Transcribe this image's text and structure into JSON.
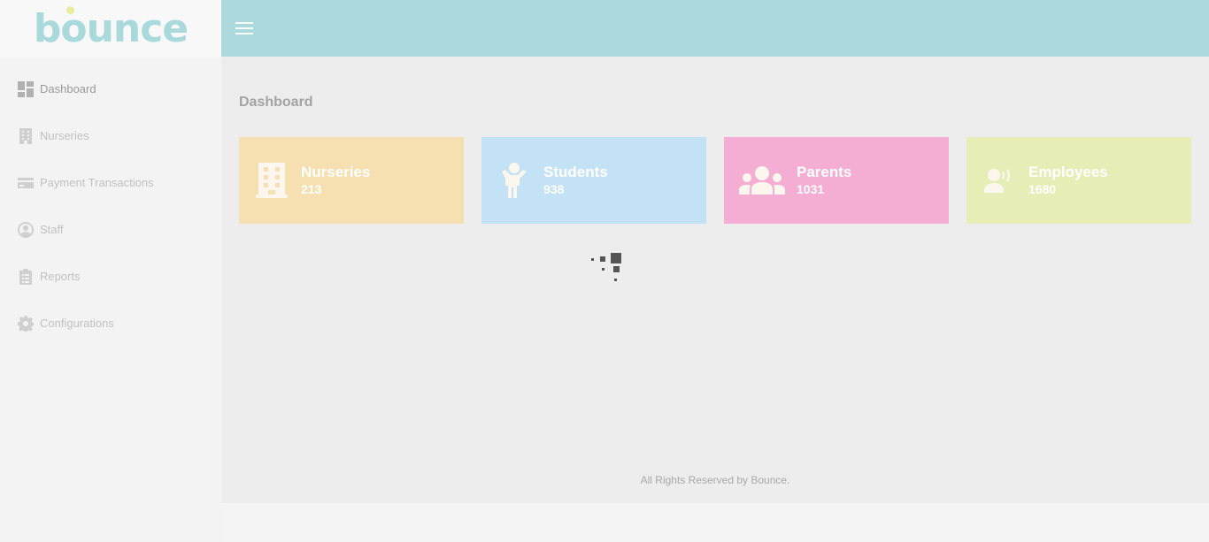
{
  "brand": {
    "logo_text": "bounce",
    "colors": {
      "logo": "#a9d9db",
      "logo_dot": "#e8ec9e",
      "topbar": "#acdadc"
    }
  },
  "sidebar": {
    "items": [
      {
        "label": "Dashboard",
        "icon": "dashboard-icon",
        "active": true
      },
      {
        "label": "Nurseries",
        "icon": "building-icon"
      },
      {
        "label": "Payment Transactions",
        "icon": "credit-card-icon"
      },
      {
        "label": "Staff",
        "icon": "user-circle-icon"
      },
      {
        "label": "Reports",
        "icon": "clipboard-list-icon"
      },
      {
        "label": "Configurations",
        "icon": "gear-icon"
      }
    ]
  },
  "topbar": {
    "menu_icon": "hamburger-icon"
  },
  "main": {
    "title": "Dashboard",
    "cards": [
      {
        "title": "Nurseries",
        "value": "213",
        "icon": "building-icon",
        "color": "#f6dfb1"
      },
      {
        "title": "Students",
        "value": "938",
        "icon": "child-icon",
        "color": "#c3e2f5"
      },
      {
        "title": "Parents",
        "value": "1031",
        "icon": "group-icon",
        "color": "#f4aed4"
      },
      {
        "title": "Employees",
        "value": "1680",
        "icon": "speaking-person-icon",
        "color": "#e6edb6"
      }
    ],
    "loading_icon": "loading-spinner-icon"
  },
  "footer": {
    "text": "All Rights Reserved by Bounce."
  }
}
